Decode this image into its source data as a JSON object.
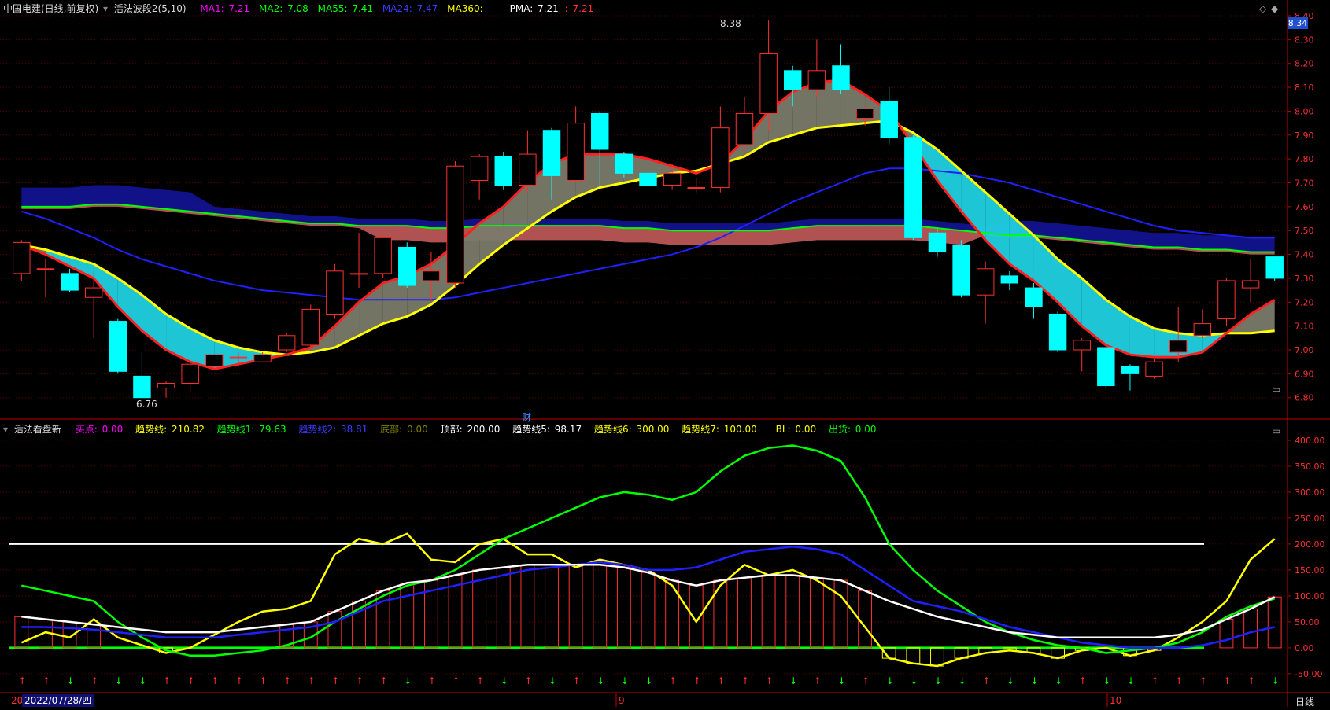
{
  "header_top": {
    "stock_label": "中国电建(日线,前复权)",
    "indicator_name": "活法波段2(5,10)",
    "ma1_label": "MA1: ",
    "ma1_value": "7.21",
    "ma2_label": "MA2: ",
    "ma2_value": "7.08",
    "ma55_label": "MA55: ",
    "ma55_value": "7.41",
    "ma24_label": "MA24: ",
    "ma24_value": "7.47",
    "ma360_label": "MA360: ",
    "ma360_value": "-",
    "pma_label": "PMA: ",
    "pma_value1": "7.21",
    "pma_value2": "7.21"
  },
  "header_bottom": {
    "indicator_name": "活法看盘新",
    "buy_label": "买点: ",
    "buy_value": "0.00",
    "trend_label": "趋势线: ",
    "trend_value": "210.82",
    "trend1_label": "趋势线1: ",
    "trend1_value": "79.63",
    "trend2_label": "趋势线2: ",
    "trend2_value": "38.81",
    "bottom_label": "底部: ",
    "bottom_value": "0.00",
    "top_label": "顶部: ",
    "top_value": "200.00",
    "trend5_label": "趋势线5: ",
    "trend5_value": "98.17",
    "trend6_label": "趋势线6: ",
    "trend6_value": "300.00",
    "trend7_label": "趋势线7: ",
    "trend7_value": "100.00",
    "bl_label": "BL: ",
    "bl_value": "0.00",
    "ship_label": "出货: ",
    "ship_value": "0.00"
  },
  "footer": {
    "date_label": "2022/07/28/四",
    "period_label": "日线",
    "month_sep_label": "9",
    "month_sep_label2": "10",
    "date_prefix": "20"
  },
  "annotations": {
    "high_label": "8.38",
    "low_label": "6.76",
    "finance_marker": "财",
    "price_tag": "8.34"
  },
  "colors": {
    "up": "#ff3030",
    "down": "#00ffff",
    "ma1": "#ff00ff",
    "ma2": "#00ff00",
    "ma55": "#00ff00",
    "ma24": "#2020ff",
    "ma360": "#ffff00",
    "pma": "#ffffff",
    "grid": "#5a0000",
    "axis": "#c00000"
  },
  "chart_data": [
    {
      "type": "candlestick",
      "title": "",
      "ylim": [
        6.72,
        8.4
      ],
      "yticks": [
        6.8,
        6.9,
        7.0,
        7.1,
        7.2,
        7.3,
        7.4,
        7.5,
        7.6,
        7.7,
        7.8,
        7.9,
        8.0,
        8.1,
        8.2,
        8.3,
        8.4
      ],
      "ytick_labels": [
        "6.80",
        "6.90",
        "7.00",
        "7.10",
        "7.20",
        "7.30",
        "7.40",
        "7.50",
        "7.60",
        "7.70",
        "7.80",
        "7.90",
        "8.00",
        "8.10",
        "8.20",
        "8.30",
        "8.40"
      ],
      "candles": [
        {
          "o": 7.32,
          "c": 7.45,
          "h": 7.46,
          "l": 7.29
        },
        {
          "o": 7.34,
          "c": 7.34,
          "h": 7.38,
          "l": 7.22
        },
        {
          "o": 7.32,
          "c": 7.25,
          "h": 7.34,
          "l": 7.24
        },
        {
          "o": 7.22,
          "c": 7.26,
          "h": 7.33,
          "l": 7.05
        },
        {
          "o": 7.12,
          "c": 6.91,
          "h": 7.13,
          "l": 6.9
        },
        {
          "o": 6.89,
          "c": 6.8,
          "h": 6.99,
          "l": 6.79
        },
        {
          "o": 6.84,
          "c": 6.86,
          "h": 6.87,
          "l": 6.8
        },
        {
          "o": 6.86,
          "c": 6.94,
          "h": 6.96,
          "l": 6.82
        },
        {
          "o": 6.93,
          "c": 6.98,
          "h": 6.98,
          "l": 6.92
        },
        {
          "o": 6.97,
          "c": 6.97,
          "h": 6.99,
          "l": 6.93
        },
        {
          "o": 6.95,
          "c": 6.98,
          "h": 6.99,
          "l": 6.95
        },
        {
          "o": 7.0,
          "c": 7.06,
          "h": 7.07,
          "l": 6.99
        },
        {
          "o": 7.02,
          "c": 7.17,
          "h": 7.19,
          "l": 7.0
        },
        {
          "o": 7.15,
          "c": 7.33,
          "h": 7.36,
          "l": 7.13
        },
        {
          "o": 7.32,
          "c": 7.32,
          "h": 7.49,
          "l": 7.26
        },
        {
          "o": 7.32,
          "c": 7.47,
          "h": 7.48,
          "l": 7.3
        },
        {
          "o": 7.43,
          "c": 7.27,
          "h": 7.45,
          "l": 7.26
        },
        {
          "o": 7.29,
          "c": 7.33,
          "h": 7.41,
          "l": 7.21
        },
        {
          "o": 7.28,
          "c": 7.77,
          "h": 7.79,
          "l": 7.26
        },
        {
          "o": 7.71,
          "c": 7.81,
          "h": 7.82,
          "l": 7.63
        },
        {
          "o": 7.81,
          "c": 7.69,
          "h": 7.83,
          "l": 7.67
        },
        {
          "o": 7.69,
          "c": 7.82,
          "h": 7.92,
          "l": 7.66
        },
        {
          "o": 7.92,
          "c": 7.73,
          "h": 7.93,
          "l": 7.63
        },
        {
          "o": 7.71,
          "c": 7.95,
          "h": 8.02,
          "l": 7.7
        },
        {
          "o": 7.99,
          "c": 7.84,
          "h": 8.0,
          "l": 7.69
        },
        {
          "o": 7.82,
          "c": 7.74,
          "h": 7.83,
          "l": 7.72
        },
        {
          "o": 7.74,
          "c": 7.69,
          "h": 7.75,
          "l": 7.67
        },
        {
          "o": 7.69,
          "c": 7.74,
          "h": 7.78,
          "l": 7.67
        },
        {
          "o": 7.68,
          "c": 7.68,
          "h": 7.72,
          "l": 7.66
        },
        {
          "o": 7.68,
          "c": 7.93,
          "h": 8.02,
          "l": 7.66
        },
        {
          "o": 7.86,
          "c": 7.99,
          "h": 8.06,
          "l": 7.82
        },
        {
          "o": 7.99,
          "c": 8.24,
          "h": 8.38,
          "l": 7.92
        },
        {
          "o": 8.17,
          "c": 8.09,
          "h": 8.19,
          "l": 8.02
        },
        {
          "o": 8.09,
          "c": 8.17,
          "h": 8.3,
          "l": 8.06
        },
        {
          "o": 8.19,
          "c": 8.09,
          "h": 8.28,
          "l": 8.07
        },
        {
          "o": 7.97,
          "c": 8.01,
          "h": 8.02,
          "l": 7.94
        },
        {
          "o": 8.04,
          "c": 7.89,
          "h": 8.1,
          "l": 7.86
        },
        {
          "o": 7.89,
          "c": 7.47,
          "h": 7.9,
          "l": 7.46
        },
        {
          "o": 7.49,
          "c": 7.41,
          "h": 7.51,
          "l": 7.39
        },
        {
          "o": 7.44,
          "c": 7.23,
          "h": 7.46,
          "l": 7.22
        },
        {
          "o": 7.23,
          "c": 7.34,
          "h": 7.37,
          "l": 7.11
        },
        {
          "o": 7.31,
          "c": 7.28,
          "h": 7.33,
          "l": 7.25
        },
        {
          "o": 7.26,
          "c": 7.18,
          "h": 7.28,
          "l": 7.13
        },
        {
          "o": 7.15,
          "c": 7.0,
          "h": 7.16,
          "l": 6.99
        },
        {
          "o": 7.0,
          "c": 7.04,
          "h": 7.05,
          "l": 6.91
        },
        {
          "o": 7.01,
          "c": 6.85,
          "h": 7.01,
          "l": 6.84
        },
        {
          "o": 6.93,
          "c": 6.9,
          "h": 6.94,
          "l": 6.83
        },
        {
          "o": 6.89,
          "c": 6.95,
          "h": 6.96,
          "l": 6.88
        },
        {
          "o": 6.99,
          "c": 7.04,
          "h": 7.18,
          "l": 6.95
        },
        {
          "o": 7.06,
          "c": 7.11,
          "h": 7.17,
          "l": 7.05
        },
        {
          "o": 7.13,
          "c": 7.29,
          "h": 7.3,
          "l": 7.1
        },
        {
          "o": 7.26,
          "c": 7.29,
          "h": 7.38,
          "l": 7.2
        },
        {
          "o": 7.39,
          "c": 7.3,
          "h": 7.39,
          "l": 7.29
        }
      ],
      "series": [
        {
          "values": [
            7.44,
            7.4,
            7.35,
            7.3,
            7.18,
            7.08,
            7.0,
            6.95,
            6.92,
            6.94,
            6.96,
            6.98,
            7.01,
            7.1,
            7.2,
            7.28,
            7.31,
            7.36,
            7.44,
            7.53,
            7.6,
            7.7,
            7.78,
            7.82,
            7.82,
            7.82,
            7.8,
            7.77,
            7.74,
            7.78,
            7.88,
            8.0,
            8.08,
            8.12,
            8.13,
            8.07,
            8.0,
            7.86,
            7.71,
            7.58,
            7.46,
            7.36,
            7.29,
            7.2,
            7.1,
            7.02,
            6.98,
            6.97,
            6.97,
            6.99,
            7.07,
            7.15,
            7.21
          ]
        },
        {
          "values": [
            7.44,
            7.42,
            7.39,
            7.36,
            7.3,
            7.23,
            7.15,
            7.09,
            7.04,
            7.01,
            6.99,
            6.98,
            6.99,
            7.01,
            7.06,
            7.11,
            7.14,
            7.19,
            7.27,
            7.36,
            7.44,
            7.51,
            7.58,
            7.64,
            7.68,
            7.7,
            7.72,
            7.74,
            7.75,
            7.78,
            7.81,
            7.87,
            7.9,
            7.93,
            7.94,
            7.95,
            7.96,
            7.91,
            7.84,
            7.75,
            7.66,
            7.57,
            7.48,
            7.38,
            7.3,
            7.21,
            7.14,
            7.09,
            7.07,
            7.06,
            7.07,
            7.07,
            7.08
          ]
        },
        {
          "values": [
            7.6,
            7.6,
            7.6,
            7.61,
            7.61,
            7.6,
            7.59,
            7.58,
            7.57,
            7.56,
            7.55,
            7.54,
            7.53,
            7.53,
            7.52,
            7.52,
            7.52,
            7.51,
            7.51,
            7.52,
            7.52,
            7.52,
            7.52,
            7.52,
            7.52,
            7.51,
            7.51,
            7.5,
            7.5,
            7.5,
            7.5,
            7.5,
            7.51,
            7.52,
            7.52,
            7.52,
            7.52,
            7.52,
            7.51,
            7.5,
            7.49,
            7.48,
            7.48,
            7.47,
            7.46,
            7.45,
            7.44,
            7.43,
            7.43,
            7.42,
            7.42,
            7.41,
            7.41
          ]
        },
        {
          "values": [
            7.58,
            7.55,
            7.51,
            7.47,
            7.42,
            7.38,
            7.35,
            7.32,
            7.29,
            7.27,
            7.25,
            7.24,
            7.23,
            7.22,
            7.21,
            7.21,
            7.21,
            7.21,
            7.22,
            7.24,
            7.26,
            7.28,
            7.3,
            7.32,
            7.34,
            7.36,
            7.38,
            7.4,
            7.43,
            7.47,
            7.52,
            7.57,
            7.62,
            7.66,
            7.7,
            7.74,
            7.76,
            7.76,
            7.75,
            7.74,
            7.72,
            7.7,
            7.67,
            7.64,
            7.61,
            7.58,
            7.55,
            7.52,
            7.5,
            7.49,
            7.48,
            7.47,
            7.47
          ]
        }
      ]
    },
    {
      "type": "line",
      "title": "",
      "ylim": [
        -85,
        415
      ],
      "yticks": [
        -50,
        0,
        50,
        100,
        150,
        200,
        250,
        300,
        350,
        400
      ],
      "ytick_labels": [
        "-50.00",
        "0.00",
        "50.00",
        "100.00",
        "150.00",
        "200.00",
        "250.00",
        "300.00",
        "350.00",
        "400.00"
      ],
      "top_line": 200,
      "series": [
        {
          "values": [
            10,
            30,
            20,
            55,
            20,
            5,
            -10,
            0,
            25,
            50,
            70,
            75,
            90,
            180,
            210,
            200,
            220,
            170,
            165,
            200,
            210,
            180,
            180,
            155,
            170,
            160,
            150,
            120,
            50,
            120,
            160,
            140,
            150,
            130,
            100,
            40,
            -20,
            -30,
            -35,
            -20,
            -10,
            -5,
            -10,
            -20,
            -5,
            0,
            -15,
            -5,
            20,
            50,
            90,
            170,
            210
          ]
        },
        {
          "values": [
            120,
            110,
            100,
            90,
            50,
            20,
            -5,
            -15,
            -15,
            -10,
            -5,
            5,
            20,
            50,
            75,
            100,
            120,
            130,
            150,
            180,
            210,
            230,
            250,
            270,
            290,
            300,
            295,
            285,
            300,
            340,
            370,
            385,
            390,
            380,
            360,
            290,
            200,
            150,
            110,
            80,
            50,
            30,
            15,
            5,
            0,
            -10,
            -5,
            0,
            10,
            30,
            60,
            80,
            95
          ]
        },
        {
          "values": [
            40,
            40,
            38,
            35,
            30,
            25,
            20,
            20,
            20,
            25,
            30,
            35,
            40,
            50,
            70,
            90,
            100,
            110,
            120,
            130,
            140,
            150,
            155,
            160,
            165,
            160,
            150,
            150,
            155,
            170,
            185,
            190,
            195,
            190,
            180,
            150,
            120,
            90,
            80,
            70,
            55,
            40,
            30,
            20,
            10,
            5,
            0,
            0,
            0,
            5,
            15,
            30,
            40
          ]
        },
        {
          "values": [
            60,
            55,
            50,
            45,
            40,
            35,
            30,
            30,
            30,
            35,
            40,
            45,
            50,
            70,
            90,
            110,
            125,
            130,
            140,
            150,
            155,
            160,
            160,
            160,
            160,
            155,
            145,
            130,
            120,
            130,
            135,
            140,
            140,
            135,
            130,
            110,
            90,
            75,
            60,
            50,
            40,
            30,
            25,
            20,
            20,
            20,
            20,
            20,
            25,
            35,
            55,
            75,
            98
          ]
        }
      ]
    }
  ]
}
